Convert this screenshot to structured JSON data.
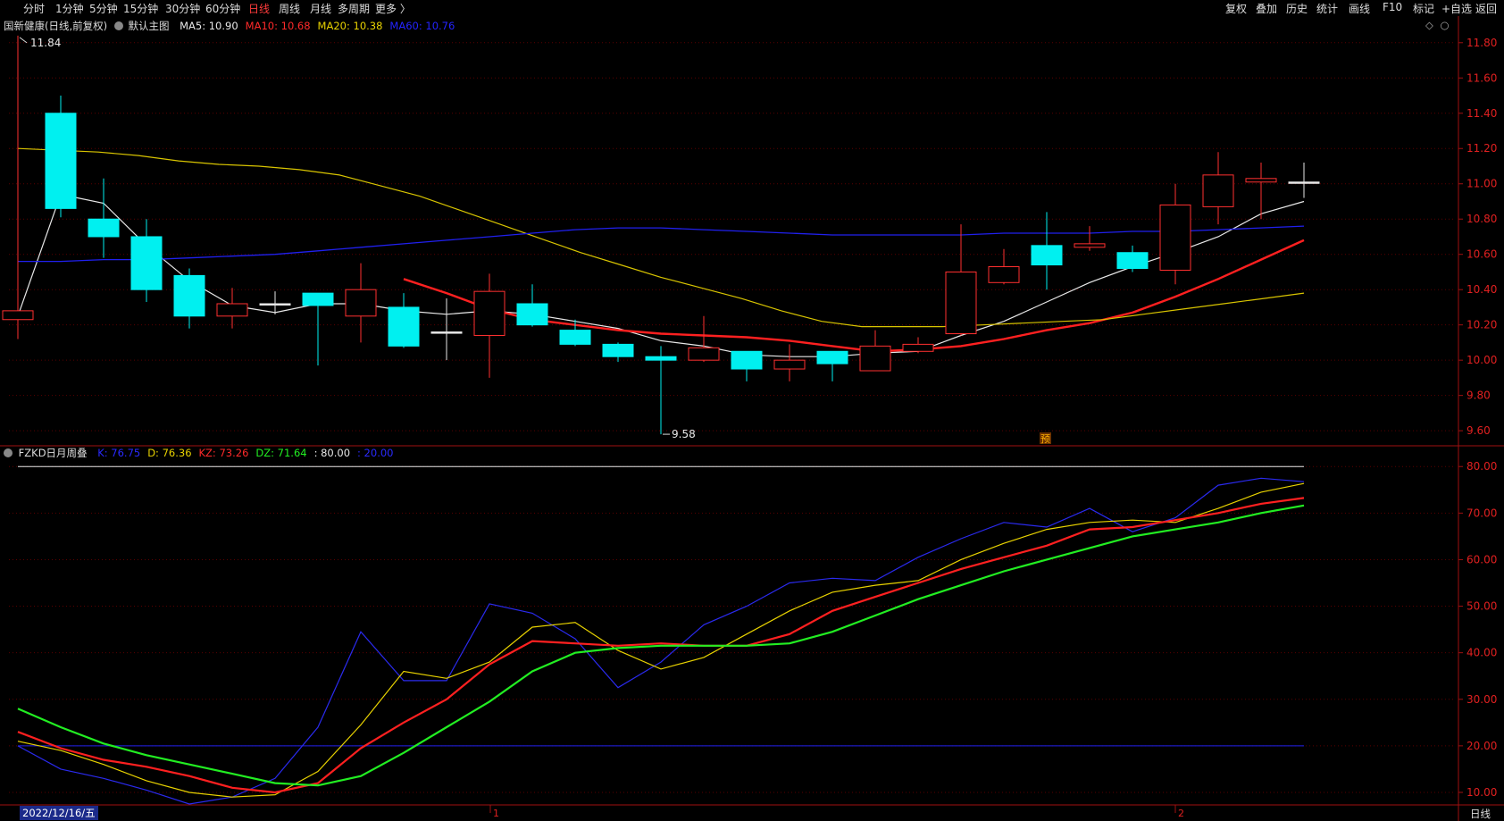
{
  "toolbar": {
    "periods": [
      "分时",
      "1分钟",
      "5分钟",
      "15分钟",
      "30分钟",
      "60分钟",
      "日线",
      "周线",
      "月线",
      "多周期",
      "更多 〉"
    ],
    "active_period": "日线",
    "tools": [
      "复权",
      "叠加",
      "历史",
      "统计",
      "画线",
      "F10",
      "标记",
      "+自选",
      "返回"
    ]
  },
  "main_panel": {
    "stock_label": "国新健康(日线,前复权)",
    "chart_name": "默认主图",
    "indicators": [
      {
        "label": "MA5: 10.90",
        "color": "#e8e8e8"
      },
      {
        "label": "MA10: 10.68",
        "color": "#ff2a2a"
      },
      {
        "label": "MA20: 10.38",
        "color": "#e8d200"
      },
      {
        "label": "MA60: 10.76",
        "color": "#2424ff"
      }
    ],
    "high_label": "11.84",
    "low_label": "9.58",
    "marker_char": "预",
    "icons": [
      "diamond-icon",
      "close-icon"
    ]
  },
  "sub_panel": {
    "name": "FZKD日月周叠",
    "indicators": [
      {
        "label": "K: 76.75",
        "color": "#2a2aff"
      },
      {
        "label": "D: 76.36",
        "color": "#e8d200"
      },
      {
        "label": "KZ: 73.26",
        "color": "#ff2a2a"
      },
      {
        "label": "DZ: 71.64",
        "color": "#22ee22"
      },
      {
        "label": ": 80.00",
        "color": "#e8e8e8"
      },
      {
        "label": ": 20.00",
        "color": "#2a2aff"
      }
    ]
  },
  "bottom": {
    "date": "2022/12/16/五",
    "month_ticks": [
      "1",
      "2"
    ],
    "period_label": "日线"
  },
  "chart_data": [
    {
      "type": "candlestick",
      "y_ticks": [
        "11.80",
        "11.60",
        "11.40",
        "11.20",
        "11.00",
        "10.80",
        "10.60",
        "10.40",
        "10.20",
        "10.00",
        "9.80",
        "9.60"
      ],
      "ylim": [
        9.55,
        11.88
      ],
      "candles": [
        {
          "o": 10.23,
          "h": 11.84,
          "l": 10.12,
          "c": 10.28
        },
        {
          "o": 11.4,
          "h": 11.5,
          "l": 10.81,
          "c": 10.86
        },
        {
          "o": 10.8,
          "h": 11.03,
          "l": 10.58,
          "c": 10.7
        },
        {
          "o": 10.7,
          "h": 10.8,
          "l": 10.33,
          "c": 10.4
        },
        {
          "o": 10.48,
          "h": 10.52,
          "l": 10.18,
          "c": 10.25
        },
        {
          "o": 10.25,
          "h": 10.41,
          "l": 10.18,
          "c": 10.32
        },
        {
          "o": 10.32,
          "h": 10.39,
          "l": 10.26,
          "c": 10.32
        },
        {
          "o": 10.38,
          "h": 10.38,
          "l": 9.97,
          "c": 10.31
        },
        {
          "o": 10.25,
          "h": 10.55,
          "l": 10.1,
          "c": 10.4
        },
        {
          "o": 10.3,
          "h": 10.38,
          "l": 10.07,
          "c": 10.08
        },
        {
          "o": 10.16,
          "h": 10.35,
          "l": 10.0,
          "c": 10.16
        },
        {
          "o": 10.14,
          "h": 10.49,
          "l": 9.9,
          "c": 10.39
        },
        {
          "o": 10.32,
          "h": 10.43,
          "l": 10.19,
          "c": 10.2
        },
        {
          "o": 10.17,
          "h": 10.23,
          "l": 10.08,
          "c": 10.09
        },
        {
          "o": 10.09,
          "h": 10.1,
          "l": 9.99,
          "c": 10.02
        },
        {
          "o": 10.02,
          "h": 10.08,
          "l": 9.58,
          "c": 10.0
        },
        {
          "o": 10.0,
          "h": 10.25,
          "l": 9.99,
          "c": 10.07
        },
        {
          "o": 10.05,
          "h": 10.05,
          "l": 9.88,
          "c": 9.95
        },
        {
          "o": 9.95,
          "h": 10.09,
          "l": 9.88,
          "c": 10.0
        },
        {
          "o": 10.05,
          "h": 10.05,
          "l": 9.88,
          "c": 9.98
        },
        {
          "o": 9.94,
          "h": 10.17,
          "l": 9.94,
          "c": 10.08
        },
        {
          "o": 10.05,
          "h": 10.13,
          "l": 10.04,
          "c": 10.09
        },
        {
          "o": 10.15,
          "h": 10.77,
          "l": 10.14,
          "c": 10.5
        },
        {
          "o": 10.44,
          "h": 10.63,
          "l": 10.43,
          "c": 10.53
        },
        {
          "o": 10.65,
          "h": 10.84,
          "l": 10.4,
          "c": 10.54
        },
        {
          "o": 10.64,
          "h": 10.76,
          "l": 10.62,
          "c": 10.66
        },
        {
          "o": 10.61,
          "h": 10.65,
          "l": 10.5,
          "c": 10.52
        },
        {
          "o": 10.51,
          "h": 11.0,
          "l": 10.43,
          "c": 10.88
        },
        {
          "o": 10.87,
          "h": 11.18,
          "l": 10.77,
          "c": 11.05
        },
        {
          "o": 11.01,
          "h": 11.12,
          "l": 10.8,
          "c": 11.03
        },
        {
          "o": 11.01,
          "h": 11.12,
          "l": 10.92,
          "c": 11.01
        }
      ],
      "ma": [
        {
          "name": "MA5",
          "values": [
            10.25,
            10.94,
            10.89,
            10.65,
            10.45,
            10.31,
            10.27,
            10.32,
            10.32,
            10.28,
            10.26,
            10.28,
            10.26,
            10.22,
            10.18,
            10.11,
            10.08,
            10.03,
            10.02,
            10.02,
            10.04,
            10.05,
            10.14,
            10.22,
            10.33,
            10.44,
            10.53,
            10.61,
            10.7,
            10.83,
            10.9
          ]
        },
        {
          "name": "MA10",
          "values": [
            10.46,
            10.38,
            10.29,
            10.23,
            10.2,
            10.17,
            10.15,
            10.14,
            10.13,
            10.11,
            10.08,
            10.05,
            10.06,
            10.08,
            10.12,
            10.17,
            10.21,
            10.27,
            10.36,
            10.46,
            10.57,
            10.68
          ]
        },
        {
          "name": "MA20",
          "values": [
            11.2,
            11.19,
            11.18,
            11.16,
            11.13,
            11.11,
            11.1,
            11.08,
            11.05,
            10.99,
            10.93,
            10.85,
            10.77,
            10.69,
            10.61,
            10.54,
            10.47,
            10.41,
            10.35,
            10.28,
            10.22,
            10.19,
            10.19,
            10.19,
            10.2,
            10.21,
            10.22,
            10.23,
            10.26,
            10.29,
            10.32,
            10.35,
            10.38
          ]
        },
        {
          "name": "MA60",
          "values": [
            10.56,
            10.56,
            10.57,
            10.57,
            10.58,
            10.59,
            10.6,
            10.62,
            10.64,
            10.66,
            10.68,
            10.7,
            10.72,
            10.74,
            10.75,
            10.75,
            10.74,
            10.73,
            10.72,
            10.71,
            10.71,
            10.71,
            10.71,
            10.72,
            10.72,
            10.72,
            10.73,
            10.73,
            10.74,
            10.75,
            10.76
          ]
        }
      ]
    },
    {
      "type": "line",
      "y_ticks": [
        "80.00",
        "70.00",
        "60.00",
        "50.00",
        "40.00",
        "30.00",
        "20.00",
        "10.00"
      ],
      "ylim": [
        7.5,
        83.5
      ],
      "levels": [
        80,
        20
      ],
      "series": [
        {
          "name": "K",
          "values": [
            20.0,
            15.0,
            13.0,
            10.5,
            7.5,
            9.0,
            13.0,
            24.0,
            44.5,
            34.0,
            34.0,
            50.5,
            48.5,
            43.0,
            32.5,
            38.0,
            46.0,
            50.0,
            55.0,
            56.0,
            55.5,
            60.5,
            64.5,
            68.0,
            67.0,
            71.0,
            66.0,
            69.0,
            76.0,
            77.5,
            76.75
          ]
        },
        {
          "name": "D",
          "values": [
            21.0,
            19.0,
            16.0,
            12.5,
            10.0,
            9.0,
            9.5,
            14.5,
            24.5,
            36.0,
            34.5,
            38.0,
            45.5,
            46.5,
            40.5,
            36.5,
            39.0,
            44.0,
            49.0,
            53.0,
            54.5,
            55.5,
            60.0,
            63.5,
            66.5,
            68.0,
            68.5,
            68.0,
            71.0,
            74.5,
            76.36
          ]
        },
        {
          "name": "KZ",
          "values": [
            23.0,
            19.5,
            17.0,
            15.5,
            13.5,
            11.0,
            10.0,
            12.0,
            19.5,
            25.0,
            30.0,
            37.5,
            42.5,
            42.0,
            41.5,
            42.0,
            41.5,
            41.5,
            44.0,
            49.0,
            52.0,
            55.0,
            58.0,
            60.5,
            63.0,
            66.5,
            67.0,
            68.5,
            70.0,
            72.0,
            73.26
          ]
        },
        {
          "name": "DZ",
          "values": [
            28.0,
            24.0,
            20.5,
            18.0,
            16.0,
            14.0,
            12.0,
            11.5,
            13.5,
            18.5,
            24.0,
            29.5,
            36.0,
            40.0,
            41.0,
            41.5,
            41.5,
            41.5,
            42.0,
            44.5,
            48.0,
            51.5,
            54.5,
            57.5,
            60.0,
            62.5,
            65.0,
            66.5,
            68.0,
            70.0,
            71.64
          ]
        }
      ]
    }
  ]
}
